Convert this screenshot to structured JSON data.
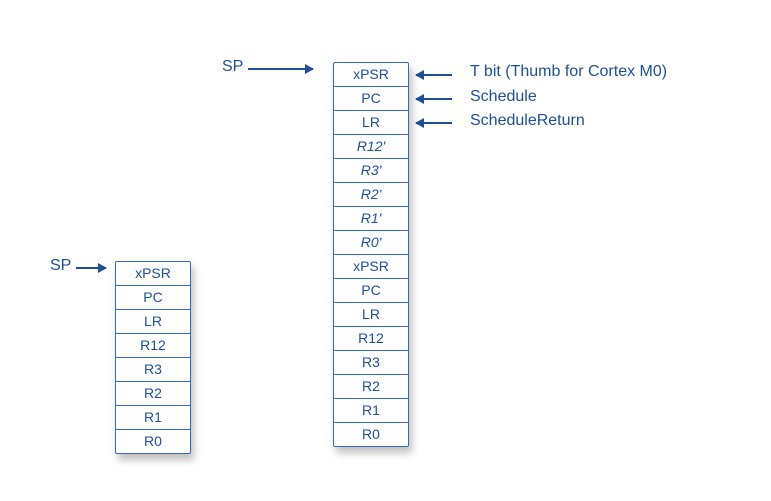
{
  "left_stack": {
    "sp_label": "SP",
    "cells": [
      "xPSR",
      "PC",
      "LR",
      "R12",
      "R3",
      "R2",
      "R1",
      "R0"
    ]
  },
  "right_stack": {
    "sp_label": "SP",
    "cells": [
      {
        "text": "xPSR",
        "italic": false
      },
      {
        "text": "PC",
        "italic": false
      },
      {
        "text": "LR",
        "italic": false
      },
      {
        "text": "R12'",
        "italic": true
      },
      {
        "text": "R3'",
        "italic": true
      },
      {
        "text": "R2'",
        "italic": true
      },
      {
        "text": "R1'",
        "italic": true
      },
      {
        "text": "R0'",
        "italic": true
      },
      {
        "text": "xPSR",
        "italic": false
      },
      {
        "text": "PC",
        "italic": false
      },
      {
        "text": "LR",
        "italic": false
      },
      {
        "text": "R12",
        "italic": false
      },
      {
        "text": "R3",
        "italic": false
      },
      {
        "text": "R2",
        "italic": false
      },
      {
        "text": "R1",
        "italic": false
      },
      {
        "text": "R0",
        "italic": false
      }
    ]
  },
  "annotations": {
    "xpsr": "T bit (Thumb for Cortex M0)",
    "pc": "Schedule",
    "lr": "ScheduleReturn"
  }
}
